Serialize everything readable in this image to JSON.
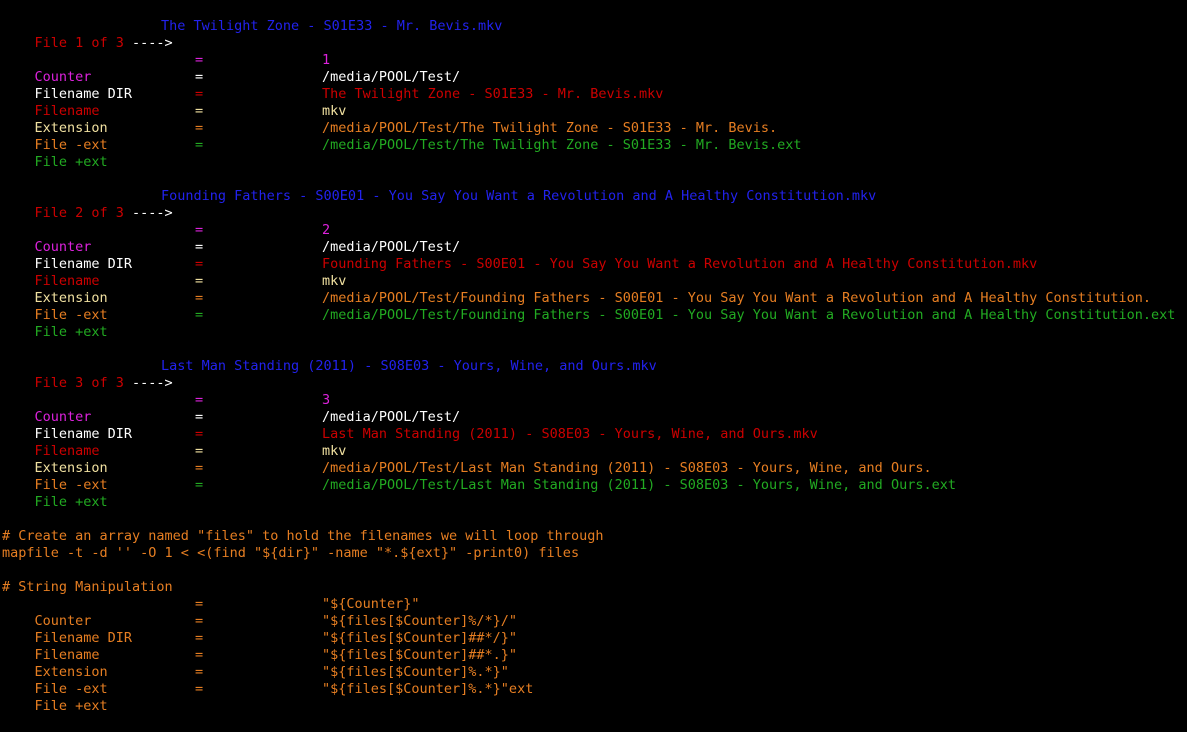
{
  "files": [
    {
      "header": {
        "label": "File 1 of 3",
        "arrow": " ---->",
        "name": "The Twilight Zone - S01E33 - Mr. Bevis.mkv"
      },
      "rows": [
        {
          "key": "Counter",
          "eq": "=",
          "value": "1",
          "color": "#dd22dd"
        },
        {
          "key": "Filename DIR",
          "eq": "=",
          "value": "/media/POOL/Test/",
          "color": "#ffffff"
        },
        {
          "key": "Filename",
          "eq": "=",
          "value": "The Twilight Zone - S01E33 - Mr. Bevis.mkv",
          "color": "#cc0000"
        },
        {
          "key": "Extension",
          "eq": "=",
          "value": "mkv",
          "color": "#f0e0a0"
        },
        {
          "key": "File -ext",
          "eq": "=",
          "value": "/media/POOL/Test/The Twilight Zone - S01E33 - Mr. Bevis.",
          "color": "#e67e22"
        },
        {
          "key": "File +ext",
          "eq": "=",
          "value": "/media/POOL/Test/The Twilight Zone - S01E33 - Mr. Bevis.ext",
          "color": "#22aa22"
        }
      ]
    },
    {
      "header": {
        "label": "File 2 of 3",
        "arrow": " ---->",
        "name": "Founding Fathers - S00E01 - You Say You Want a Revolution and A Healthy Constitution.mkv"
      },
      "rows": [
        {
          "key": "Counter",
          "eq": "=",
          "value": "2",
          "color": "#dd22dd"
        },
        {
          "key": "Filename DIR",
          "eq": "=",
          "value": "/media/POOL/Test/",
          "color": "#ffffff"
        },
        {
          "key": "Filename",
          "eq": "=",
          "value": "Founding Fathers - S00E01 - You Say You Want a Revolution and A Healthy Constitution.mkv",
          "color": "#cc0000"
        },
        {
          "key": "Extension",
          "eq": "=",
          "value": "mkv",
          "color": "#f0e0a0"
        },
        {
          "key": "File -ext",
          "eq": "=",
          "value": "/media/POOL/Test/Founding Fathers - S00E01 - You Say You Want a Revolution and A Healthy Constitution.",
          "color": "#e67e22"
        },
        {
          "key": "File +ext",
          "eq": "=",
          "value": "/media/POOL/Test/Founding Fathers - S00E01 - You Say You Want a Revolution and A Healthy Constitution.ext",
          "color": "#22aa22"
        }
      ]
    },
    {
      "header": {
        "label": "File 3 of 3",
        "arrow": " ---->",
        "name": "Last Man Standing (2011) - S08E03 - Yours, Wine, and Ours.mkv"
      },
      "rows": [
        {
          "key": "Counter",
          "eq": "=",
          "value": "3",
          "color": "#dd22dd"
        },
        {
          "key": "Filename DIR",
          "eq": "=",
          "value": "/media/POOL/Test/",
          "color": "#ffffff"
        },
        {
          "key": "Filename",
          "eq": "=",
          "value": "Last Man Standing (2011) - S08E03 - Yours, Wine, and Ours.mkv",
          "color": "#cc0000"
        },
        {
          "key": "Extension",
          "eq": "=",
          "value": "mkv",
          "color": "#f0e0a0"
        },
        {
          "key": "File -ext",
          "eq": "=",
          "value": "/media/POOL/Test/Last Man Standing (2011) - S08E03 - Yours, Wine, and Ours.",
          "color": "#e67e22"
        },
        {
          "key": "File +ext",
          "eq": "=",
          "value": "/media/POOL/Test/Last Man Standing (2011) - S08E03 - Yours, Wine, and Ours.ext",
          "color": "#22aa22"
        }
      ]
    }
  ],
  "code": {
    "comment1": "# Create an array named \"files\" to hold the filenames we will loop through",
    "mapfile": "mapfile -t -d '' -O 1 < <(find \"${dir}\" -name \"*.${ext}\" -print0) files",
    "comment2": "# String Manipulation",
    "rows": [
      {
        "key": "Counter",
        "eq": "=",
        "value": "\"${Counter}\""
      },
      {
        "key": "Filename DIR",
        "eq": "=",
        "value": "\"${files[$Counter]%/*}/\""
      },
      {
        "key": "Filename",
        "eq": "=",
        "value": "\"${files[$Counter]##*/}\""
      },
      {
        "key": "Extension",
        "eq": "=",
        "value": "\"${files[$Counter]##*.}\""
      },
      {
        "key": "File -ext",
        "eq": "=",
        "value": "\"${files[$Counter]%.*}\""
      },
      {
        "key": "File +ext",
        "eq": "=",
        "value": "\"${files[$Counter]%.*}\"ext"
      }
    ]
  },
  "colors": {
    "background": "#000000",
    "header_label": "#cc0000",
    "header_arrow": "#ffffff",
    "header_name": "#2222ee",
    "code": "#e67e22"
  }
}
